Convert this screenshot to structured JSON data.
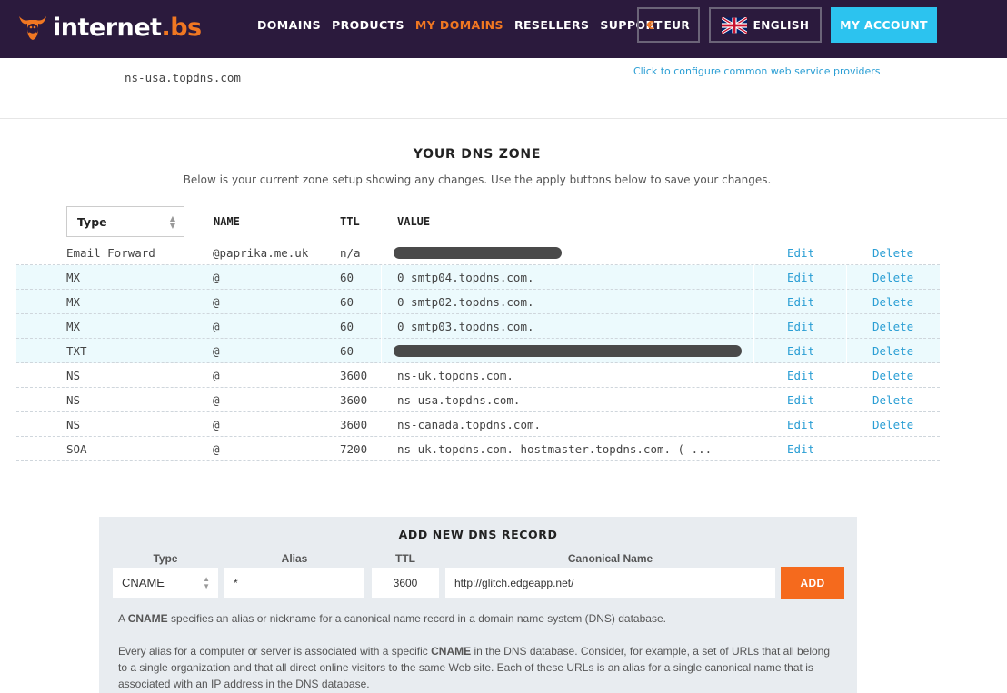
{
  "header": {
    "logo_main": "internet",
    "logo_suffix": ".bs",
    "nav": [
      "DOMAINS",
      "PRODUCTS",
      "MY DOMAINS",
      "RESELLERS",
      "SUPPORT"
    ],
    "active_nav": "MY DOMAINS",
    "currency_symbol": "€",
    "currency": "EUR",
    "language": "ENGLISH",
    "account_button": "MY ACCOUNT",
    "colors": {
      "bg": "#2b1a3d",
      "accent": "#f07722",
      "account": "#2cc3ef"
    }
  },
  "above": {
    "ns_line": "ns-usa.topdns.com",
    "config_link": "Click to configure common web service providers"
  },
  "zone": {
    "title": "YOUR DNS ZONE",
    "subtitle": "Below is your current zone setup showing any changes. Use the apply buttons below to save your changes.",
    "type_filter": "Type",
    "columns": {
      "name": "NAME",
      "ttl": "TTL",
      "value": "VALUE"
    },
    "edit_label": "Edit",
    "delete_label": "Delete",
    "rows": [
      {
        "type": "Email Forward",
        "name": "@paprika.me.uk",
        "ttl": "n/a",
        "value": "",
        "redacted": true,
        "highlight": false,
        "delete": true
      },
      {
        "type": "MX",
        "name": "@",
        "ttl": "60",
        "value": "0 smtp04.topdns.com.",
        "redacted": false,
        "highlight": true,
        "delete": true
      },
      {
        "type": "MX",
        "name": "@",
        "ttl": "60",
        "value": "0 smtp02.topdns.com.",
        "redacted": false,
        "highlight": true,
        "delete": true
      },
      {
        "type": "MX",
        "name": "@",
        "ttl": "60",
        "value": "0 smtp03.topdns.com.",
        "redacted": false,
        "highlight": true,
        "delete": true
      },
      {
        "type": "TXT",
        "name": "@",
        "ttl": "60",
        "value": "",
        "redacted": true,
        "highlight": true,
        "delete": true
      },
      {
        "type": "NS",
        "name": "@",
        "ttl": "3600",
        "value": "ns-uk.topdns.com.",
        "redacted": false,
        "highlight": false,
        "delete": true
      },
      {
        "type": "NS",
        "name": "@",
        "ttl": "3600",
        "value": "ns-usa.topdns.com.",
        "redacted": false,
        "highlight": false,
        "delete": true
      },
      {
        "type": "NS",
        "name": "@",
        "ttl": "3600",
        "value": "ns-canada.topdns.com.",
        "redacted": false,
        "highlight": false,
        "delete": true
      },
      {
        "type": "SOA",
        "name": "@",
        "ttl": "7200",
        "value": "ns-uk.topdns.com. hostmaster.topdns.com. ( ...",
        "redacted": false,
        "highlight": false,
        "delete": false
      }
    ]
  },
  "add_record": {
    "title": "ADD NEW DNS RECORD",
    "labels": {
      "type": "Type",
      "alias": "Alias",
      "ttl": "TTL",
      "canonical": "Canonical Name"
    },
    "type_value": "CNAME",
    "alias_value": "*",
    "ttl_value": "3600",
    "canonical_value": "http://glitch.edgeapp.net/",
    "add_button": "ADD",
    "desc_1_pre": "A ",
    "desc_1_bold": "CNAME",
    "desc_1_post": " specifies an alias or nickname for a canonical name record in a domain name system (DNS) database.",
    "desc_2_pre": "Every alias for a computer or server is associated with a specific ",
    "desc_2_bold": "CNAME",
    "desc_2_post": " in the DNS database. Consider, for example, a set of URLs that all belong to a single organization and that all direct online visitors to the same Web site. Each of these URLs is an alias for a single canonical name that is associated with an IP address in the DNS database."
  }
}
